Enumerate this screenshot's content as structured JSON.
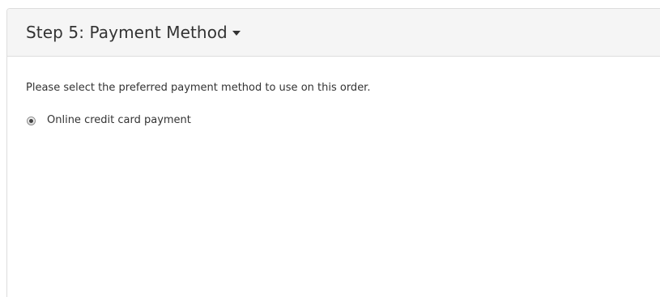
{
  "panel": {
    "title": "Step 5: Payment Method",
    "caret_icon": "caret-down-icon"
  },
  "body": {
    "intro": "Please select the preferred payment method to use on this order.",
    "payment_options": [
      {
        "label": "Online credit card payment",
        "selected": true
      }
    ]
  }
}
